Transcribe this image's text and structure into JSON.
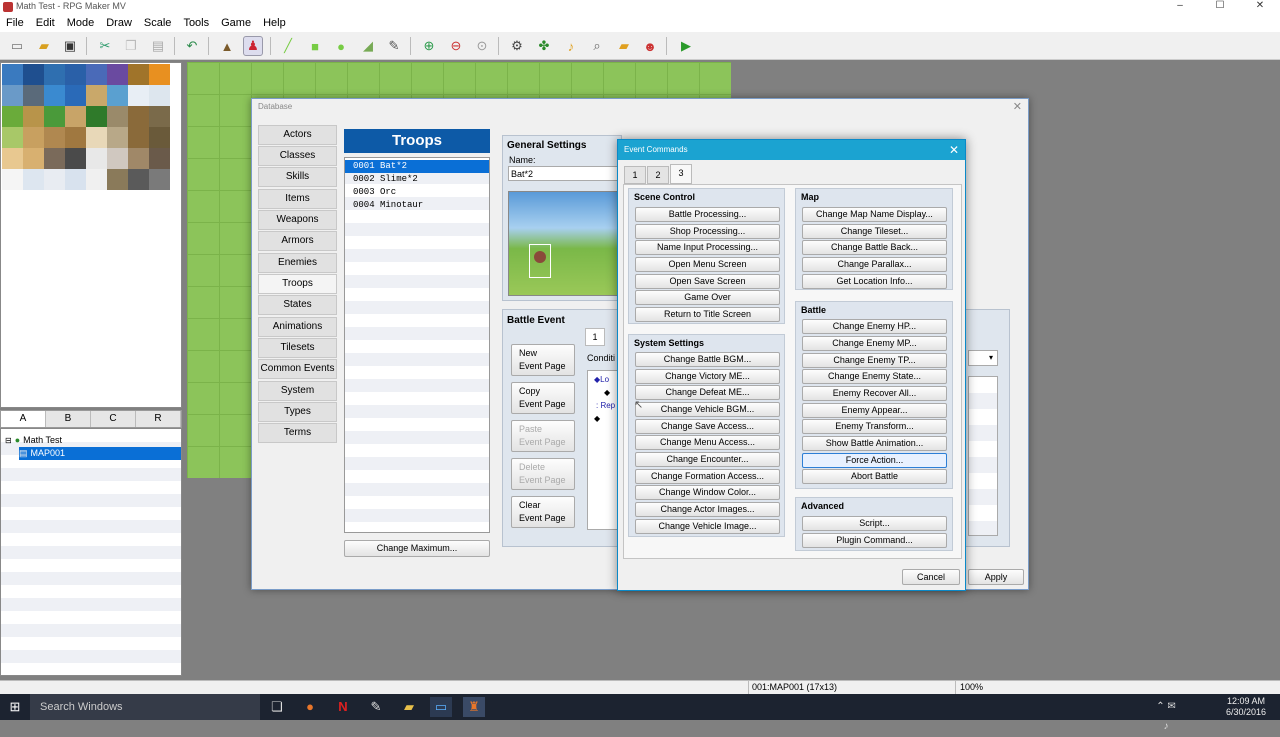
{
  "window": {
    "title": "Math Test - RPG Maker MV"
  },
  "menu": [
    "File",
    "Edit",
    "Mode",
    "Draw",
    "Scale",
    "Tools",
    "Game",
    "Help"
  ],
  "toolbar": {
    "icons": [
      "new-project-icon",
      "open-project-icon",
      "save-project-icon",
      "cut-icon",
      "copy-icon",
      "paste-icon",
      "undo-icon",
      "map-mode-icon",
      "event-mode-icon",
      "pencil-icon",
      "rectangle-icon",
      "ellipse-icon",
      "flood-fill-icon",
      "shadow-pen-icon",
      "zoom-in-icon",
      "zoom-out-icon",
      "actual-size-icon",
      "database-icon",
      "plugin-manager-icon",
      "sound-test-icon",
      "event-searcher-icon",
      "resource-manager-icon",
      "character-generator-icon",
      "playtest-icon"
    ]
  },
  "tileset_tabs": [
    "A",
    "B",
    "C",
    "R"
  ],
  "map_tree": {
    "project": "Math Test",
    "map": "MAP001"
  },
  "status": {
    "map_info": "001:MAP001 (17x13)",
    "zoom": "100%"
  },
  "taskbar": {
    "search_placeholder": "Search Windows",
    "time": "12:09 AM",
    "date": "6/30/2016"
  },
  "database": {
    "title": "Database",
    "categories": [
      "Actors",
      "Classes",
      "Skills",
      "Items",
      "Weapons",
      "Armors",
      "Enemies",
      "Troops",
      "States",
      "Animations",
      "Tilesets",
      "Common Events",
      "System",
      "Types",
      "Terms"
    ],
    "selected_category": "Troops",
    "troops_header": "Troops",
    "troops": [
      "0001 Bat*2",
      "0002 Slime*2",
      "0003 Orc",
      "0004 Minotaur"
    ],
    "change_max_label": "Change Maximum...",
    "general_settings": {
      "label": "General Settings",
      "name_label": "Name:",
      "name_value": "Bat*2"
    },
    "battle_event": {
      "label": "Battle Event",
      "page_tab": "1",
      "conditions_label": "Conditi",
      "buttons": [
        {
          "line1": "New",
          "line2": "Event Page",
          "enabled": true
        },
        {
          "line1": "Copy",
          "line2": "Event Page",
          "enabled": true
        },
        {
          "line1": "Paste",
          "line2": "Event Page",
          "enabled": false
        },
        {
          "line1": "Delete",
          "line2": "Event Page",
          "enabled": false
        },
        {
          "line1": "Clear",
          "line2": "Event Page",
          "enabled": true
        }
      ],
      "list_partial": [
        "Lo",
        "",
        ": Rep",
        ""
      ]
    },
    "apply_label": "Apply"
  },
  "event_commands": {
    "title": "Event Commands",
    "tabs": [
      "1",
      "2",
      "3"
    ],
    "selected_tab": "3",
    "scene_control": {
      "label": "Scene Control",
      "items": [
        "Battle Processing...",
        "Shop Processing...",
        "Name Input Processing...",
        "Open Menu Screen",
        "Open Save Screen",
        "Game Over",
        "Return to Title Screen"
      ]
    },
    "system_settings": {
      "label": "System Settings",
      "items": [
        "Change Battle BGM...",
        "Change Victory ME...",
        "Change Defeat ME...",
        "Change Vehicle BGM...",
        "Change Save Access...",
        "Change Menu Access...",
        "Change Encounter...",
        "Change Formation Access...",
        "Change Window Color...",
        "Change Actor Images...",
        "Change Vehicle Image..."
      ]
    },
    "map": {
      "label": "Map",
      "items": [
        "Change Map Name Display...",
        "Change Tileset...",
        "Change Battle Back...",
        "Change Parallax...",
        "Get Location Info..."
      ]
    },
    "battle": {
      "label": "Battle",
      "items": [
        "Change Enemy HP...",
        "Change Enemy MP...",
        "Change Enemy TP...",
        "Change Enemy State...",
        "Enemy Recover All...",
        "Enemy Appear...",
        "Enemy Transform...",
        "Show Battle Animation...",
        "Force Action...",
        "Abort Battle"
      ],
      "highlighted": "Force Action..."
    },
    "advanced": {
      "label": "Advanced",
      "items": [
        "Script...",
        "Plugin Command..."
      ]
    },
    "cancel_label": "Cancel"
  }
}
